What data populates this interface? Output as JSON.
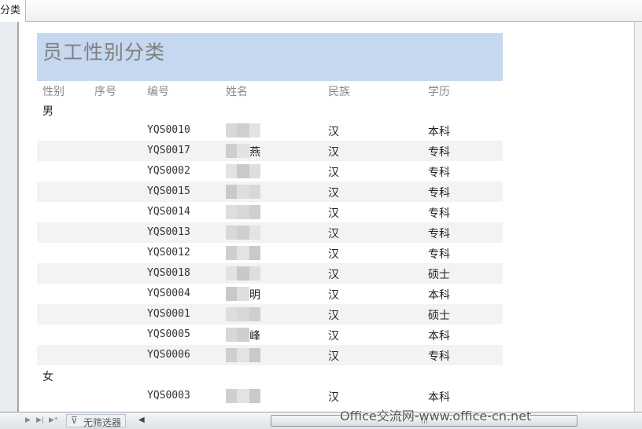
{
  "tab": {
    "label": "分类"
  },
  "report": {
    "title": "员工性别分类",
    "headers": [
      "性别",
      "序号",
      "编号",
      "姓名",
      "民族",
      "学历"
    ],
    "groups": [
      {
        "label": "男",
        "rows": [
          {
            "code": "YQS0010",
            "name_visible": "",
            "ethnicity": "汉",
            "education": "本科"
          },
          {
            "code": "YQS0017",
            "name_visible": "燕",
            "ethnicity": "汉",
            "education": "专科"
          },
          {
            "code": "YQS0002",
            "name_visible": "",
            "ethnicity": "汉",
            "education": "专科"
          },
          {
            "code": "YQS0015",
            "name_visible": "",
            "ethnicity": "汉",
            "education": "专科"
          },
          {
            "code": "YQS0014",
            "name_visible": "",
            "ethnicity": "汉",
            "education": "专科"
          },
          {
            "code": "YQS0013",
            "name_visible": "",
            "ethnicity": "汉",
            "education": "专科"
          },
          {
            "code": "YQS0012",
            "name_visible": "",
            "ethnicity": "汉",
            "education": "专科"
          },
          {
            "code": "YQS0018",
            "name_visible": "",
            "ethnicity": "汉",
            "education": "硕士"
          },
          {
            "code": "YQS0004",
            "name_visible": "明",
            "ethnicity": "汉",
            "education": "本科"
          },
          {
            "code": "YQS0001",
            "name_visible": "",
            "ethnicity": "汉",
            "education": "硕士"
          },
          {
            "code": "YQS0005",
            "name_visible": "峰",
            "ethnicity": "汉",
            "education": "本科"
          },
          {
            "code": "YQS0006",
            "name_visible": "",
            "ethnicity": "汉",
            "education": "专科"
          }
        ]
      },
      {
        "label": "女",
        "rows": [
          {
            "code": "YQS0003",
            "name_visible": "",
            "ethnicity": "汉",
            "education": "本科"
          }
        ]
      }
    ]
  },
  "statusbar": {
    "filter_label": "无筛选器"
  },
  "watermark": "Office交流网-www.office-cn.net",
  "colors": {
    "title_band": "#c6d8ef",
    "title_text": "#7f7f7f",
    "alt_row": "#f3f3f3"
  }
}
